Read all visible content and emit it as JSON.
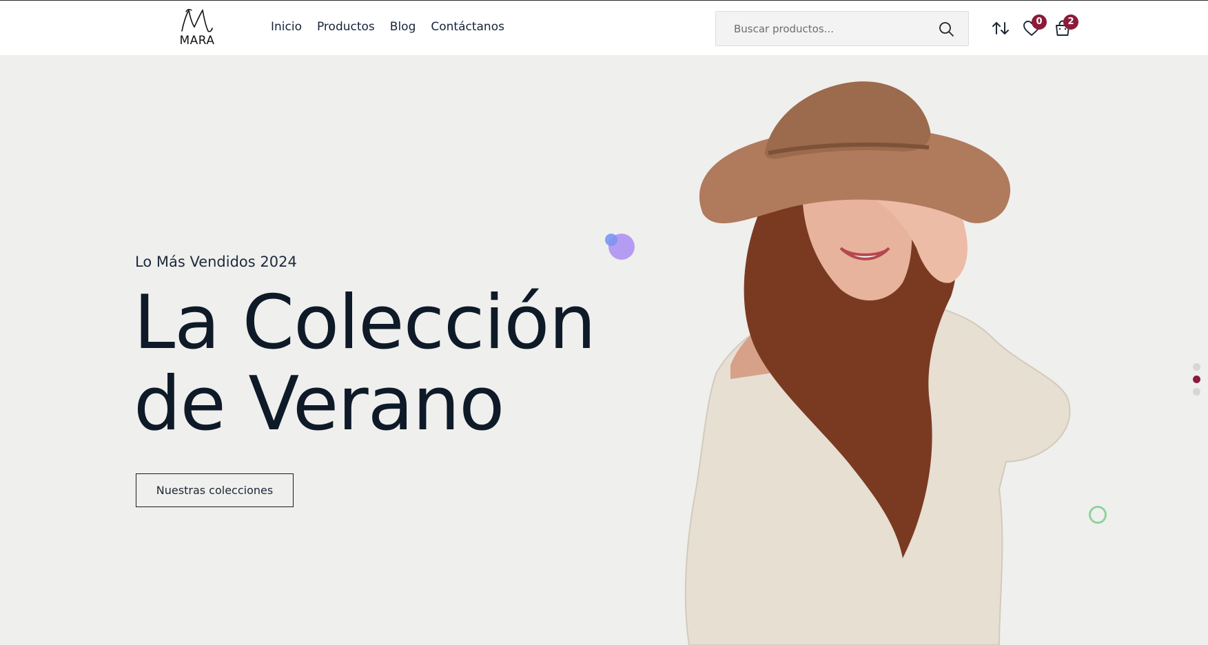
{
  "brand": {
    "logo_text": "MARA"
  },
  "nav": {
    "items": [
      {
        "label": "Inicio"
      },
      {
        "label": "Productos"
      },
      {
        "label": "Blog"
      },
      {
        "label": "Contáctanos"
      }
    ]
  },
  "search": {
    "placeholder": "Buscar productos..."
  },
  "header_actions": {
    "wishlist_count": "0",
    "cart_count": "2"
  },
  "hero": {
    "eyebrow": "Lo Más Vendidos 2024",
    "title_line1": "La Colección",
    "title_line2": "de Verano",
    "cta_label": "Nuestras colecciones"
  },
  "slider": {
    "slide_count": 3,
    "active_index": 1
  },
  "colors": {
    "accent": "#8b1a3b",
    "hero_bg": "#efefed",
    "heading": "#0e1a28"
  },
  "icons": [
    "search-icon",
    "compare-icon",
    "heart-icon",
    "shopping-bag-icon"
  ]
}
